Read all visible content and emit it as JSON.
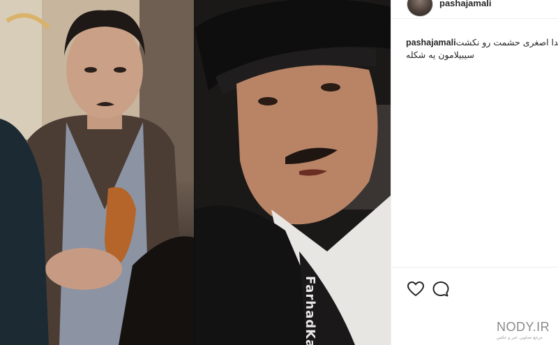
{
  "post": {
    "username": "pashajamali",
    "caption_username": "pashajamali",
    "caption_line1": "بخدا اصغری حشمت رو نکشت",
    "caption_line2": "سیبیلامون یه شکله"
  },
  "image": {
    "watermark": "FarhadKal"
  },
  "brand": {
    "name": "NODY.IR",
    "tagline": "مرجع تصاویر، خبر و عکس"
  },
  "icons": {
    "like": "heart-icon",
    "comment": "comment-icon"
  }
}
